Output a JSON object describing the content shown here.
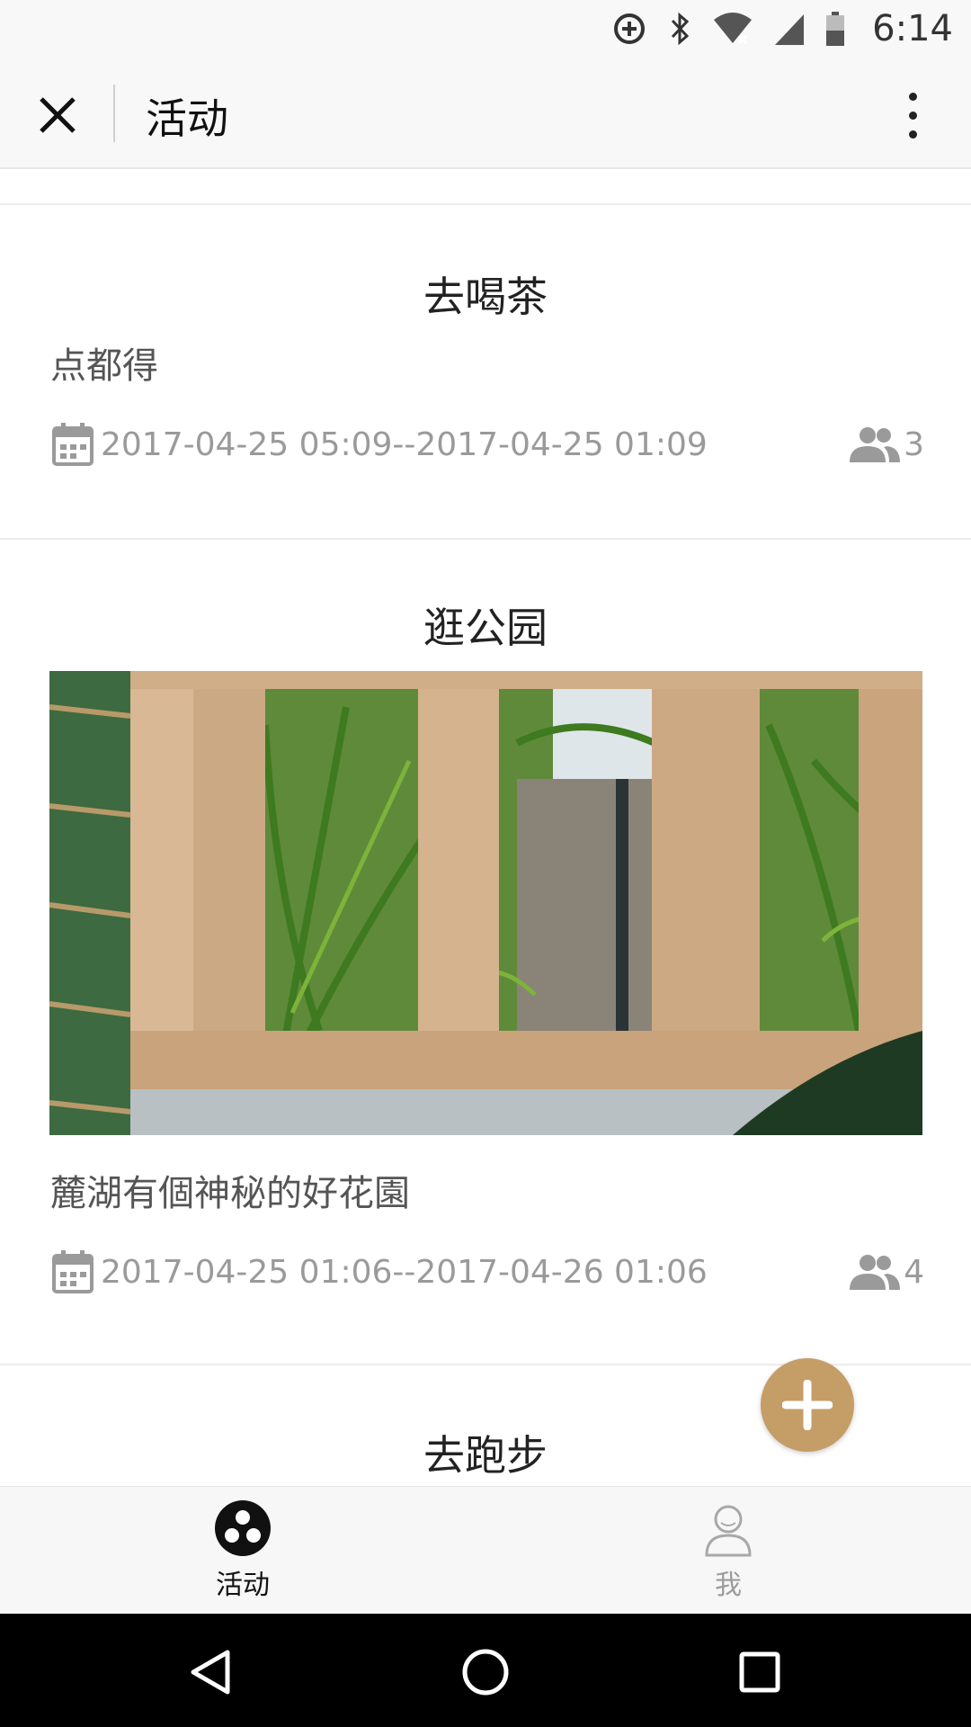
{
  "status_bar": {
    "time": "6:14",
    "icons": [
      "data-saver-icon",
      "bluetooth-icon",
      "wifi-icon",
      "cellular-signal-icon",
      "battery-icon"
    ]
  },
  "header": {
    "title": "活动",
    "close_icon": "close-icon",
    "more_icon": "more-vertical-icon"
  },
  "activities": [
    {
      "title": "去喝茶",
      "description": "点都得",
      "time_range": "2017-04-25 05:09--2017-04-25 01:09",
      "participants": "3",
      "has_image": false
    },
    {
      "title": "逛公园",
      "description": "麓湖有個神秘的好花園",
      "time_range": "2017-04-25 01:06--2017-04-26 01:06",
      "participants": "4",
      "has_image": true,
      "image_subject": "palm leaves seen through a stone wall"
    },
    {
      "title": "去跑步"
    }
  ],
  "fab": {
    "icon": "plus-icon",
    "color": "#c59d66"
  },
  "tab_bar": {
    "tabs": [
      {
        "label": "活动",
        "icon": "activity-icon",
        "active": true
      },
      {
        "label": "我",
        "icon": "profile-icon",
        "active": false
      }
    ]
  },
  "nav_bar": {
    "icons": [
      "back-icon",
      "home-icon",
      "recents-icon"
    ]
  }
}
